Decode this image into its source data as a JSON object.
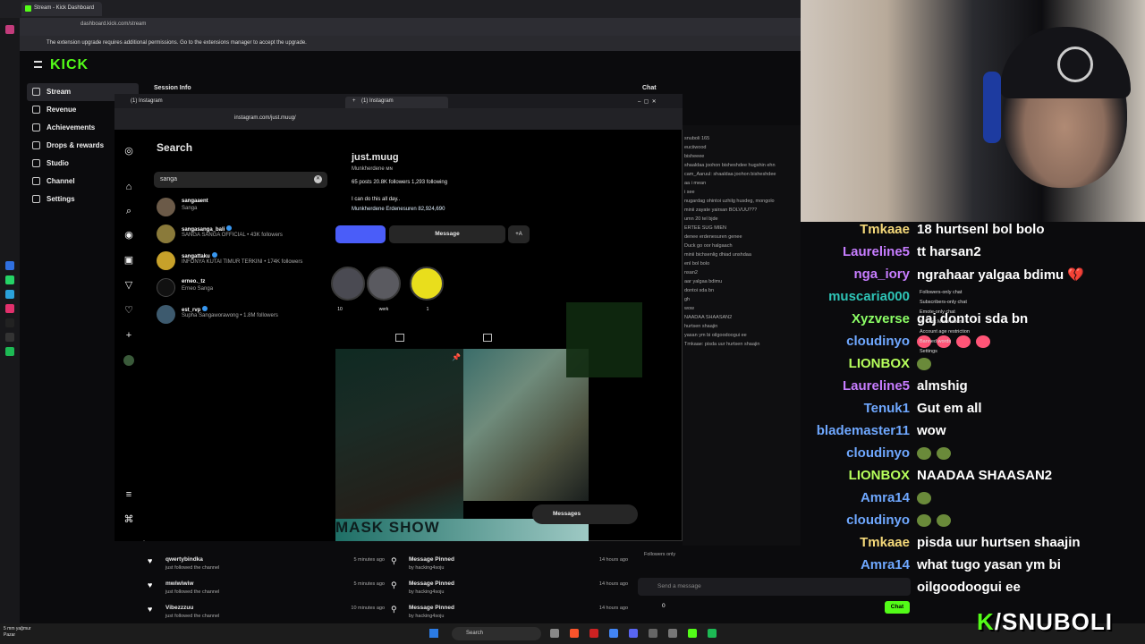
{
  "browser": {
    "tab_title": "Stream - Kick Dashboard",
    "url": "dashboard.kick.com/stream",
    "extension_banner": "The extension upgrade requires additional permissions. Go to the extensions manager to accept the upgrade."
  },
  "kick": {
    "logo": "KICK",
    "menu": [
      "Stream",
      "Revenue",
      "Achievements",
      "Drops & rewards",
      "Studio",
      "Channel",
      "Settings"
    ],
    "session_info": "Session Info",
    "chat_title": "Chat",
    "chat_lines": [
      "snuboli 165",
      "euciiwood",
      "bisheeee",
      "shaaldaa joohon bisheshdee hugshin ehn",
      "cam_Aaruul: shaaldaa joohon bisheshdee",
      "aa i mean",
      "i see",
      "nugardag ohintoi uzhilg husdeg, mongolo",
      "minii zayate yairsan BOLVUU???",
      "umn 20 tel bjde",
      "ERTEE SUG MIEN",
      "denee erdenesuren genee",
      "Duck go oor halgaach",
      "minii bichsenlig dhiad unshdaa",
      "enl bol bolo",
      "nsan2",
      "aar yalgaa bdimu",
      "dontoi sda bn",
      "gh",
      "wow",
      "NAADAA SHAASAN2",
      "hurtsen shaajin",
      "yasan ym bi oilgoodoogui ee",
      "Tmkaae: pisda uur hurtsen shaajin"
    ],
    "followers_only": "Followers only",
    "send_placeholder": "Send a message",
    "chat_button": "Chat",
    "viewer_count": "0"
  },
  "instagram": {
    "tab1": "(1) Instagram",
    "tab2": "(1) Instagram",
    "url": "instagram.com/just.muug/",
    "search_title": "Search",
    "search_value": "sanga",
    "results": [
      {
        "user": "sangaaent",
        "sub": "Sanga",
        "verified": false
      },
      {
        "user": "sangasanga_bali",
        "sub": "SANGA SANGA OFFICIAL • 43K followers",
        "verified": true
      },
      {
        "user": "sangattaku",
        "sub": "INFONYA KUTAI TIMUR TERKINI • 174K followers",
        "verified": true
      },
      {
        "user": "erneo._tz",
        "sub": "Erneo Sanga",
        "verified": false
      },
      {
        "user": "est_rvp",
        "sub": "Supha Sangaworawong • 1.8M followers",
        "verified": true
      }
    ],
    "profile": {
      "username": "just.muug",
      "category": "Munkherdene ᴍɴ",
      "stats": "65 posts   20.8K followers   1,293 following",
      "bio": "I can do this all day..",
      "link": "Munkherdene Erdenesuren   82,924,690",
      "message_btn": "Message",
      "add_btn": "+A",
      "highlights": [
        "10",
        "werk",
        "1"
      ]
    },
    "post_banner": "MASK SHOW",
    "messages_label": "Messages"
  },
  "overlay_chat": [
    {
      "name": "Tmkaae",
      "color": "#f5d97a",
      "msg": "18 hurtsenl bol bolo"
    },
    {
      "name": "Laureline5",
      "color": "#c77dff",
      "msg": "tt harsan2"
    },
    {
      "name": "nga_iory",
      "color": "#c77dff",
      "msg": "ngrahaar yalgaa bdimu 💔"
    },
    {
      "name": "muscaria000",
      "color": "#2ec4b6",
      "msg": ""
    },
    {
      "name": "Xyzverse",
      "color": "#8cff66",
      "msg": "gaj dontoi sda bn"
    },
    {
      "name": "cloudinyo",
      "color": "#6fa8ff",
      "msg": "",
      "emotes": 4
    },
    {
      "name": "LIONBOX",
      "color": "#b7ff5c",
      "msg": "",
      "emotes": 1
    },
    {
      "name": "Laureline5",
      "color": "#c77dff",
      "msg": "almshig"
    },
    {
      "name": "Tenuk1",
      "color": "#6fa8ff",
      "msg": "Gut em all"
    },
    {
      "name": "blademaster11",
      "color": "#6fa8ff",
      "msg": "wow"
    },
    {
      "name": "cloudinyo",
      "color": "#6fa8ff",
      "msg": "",
      "emotes": 2
    },
    {
      "name": "LIONBOX",
      "color": "#b7ff5c",
      "msg": "NAADAA SHAASAN2"
    },
    {
      "name": "Amra14",
      "color": "#6fa8ff",
      "msg": "",
      "emotes": 1
    },
    {
      "name": "cloudinyo",
      "color": "#6fa8ff",
      "msg": "",
      "emotes": 2
    },
    {
      "name": "Tmkaae",
      "color": "#f5d97a",
      "msg": "pisda uur hurtsen shaajin"
    },
    {
      "name": "Amra14",
      "color": "#6fa8ff",
      "msg": "what tugo yasan ym bi"
    },
    {
      "name": "",
      "color": "#fff",
      "msg": "oilgoodoogui ee"
    }
  ],
  "overlay_menu": [
    "Followers-only chat",
    "Subscribers-only chat",
    "Emote-only chat",
    "AI Chat Moderation",
    "Account age restriction",
    "Banned words",
    "Settings"
  ],
  "events": [
    {
      "name": "qwertybindka",
      "desc": "just followed the channel",
      "time": "5 minutes ago"
    },
    {
      "name": "mwiwiwiw",
      "desc": "just followed the channel",
      "time": "5 minutes ago"
    },
    {
      "name": "Vibezzzuu",
      "desc": "just followed the channel",
      "time": "10 minutes ago"
    },
    {
      "name": "Message Pinned",
      "desc": "by hacking4soju",
      "time": "14 hours ago"
    },
    {
      "name": "Message Pinned",
      "desc": "by hacking4soju",
      "time": "14 hours ago"
    },
    {
      "name": "Message Pinned",
      "desc": "by hacking4soju",
      "time": "14 hours ago"
    }
  ],
  "taskbar": {
    "weather": "5 mm yağmur",
    "day": "Pazar",
    "search": "Search"
  },
  "brand": {
    "prefix": "K",
    "name": "/SNUBOLI"
  },
  "colors": {
    "kick_green": "#53fc18",
    "instagram_blue": "#4a5df9"
  }
}
